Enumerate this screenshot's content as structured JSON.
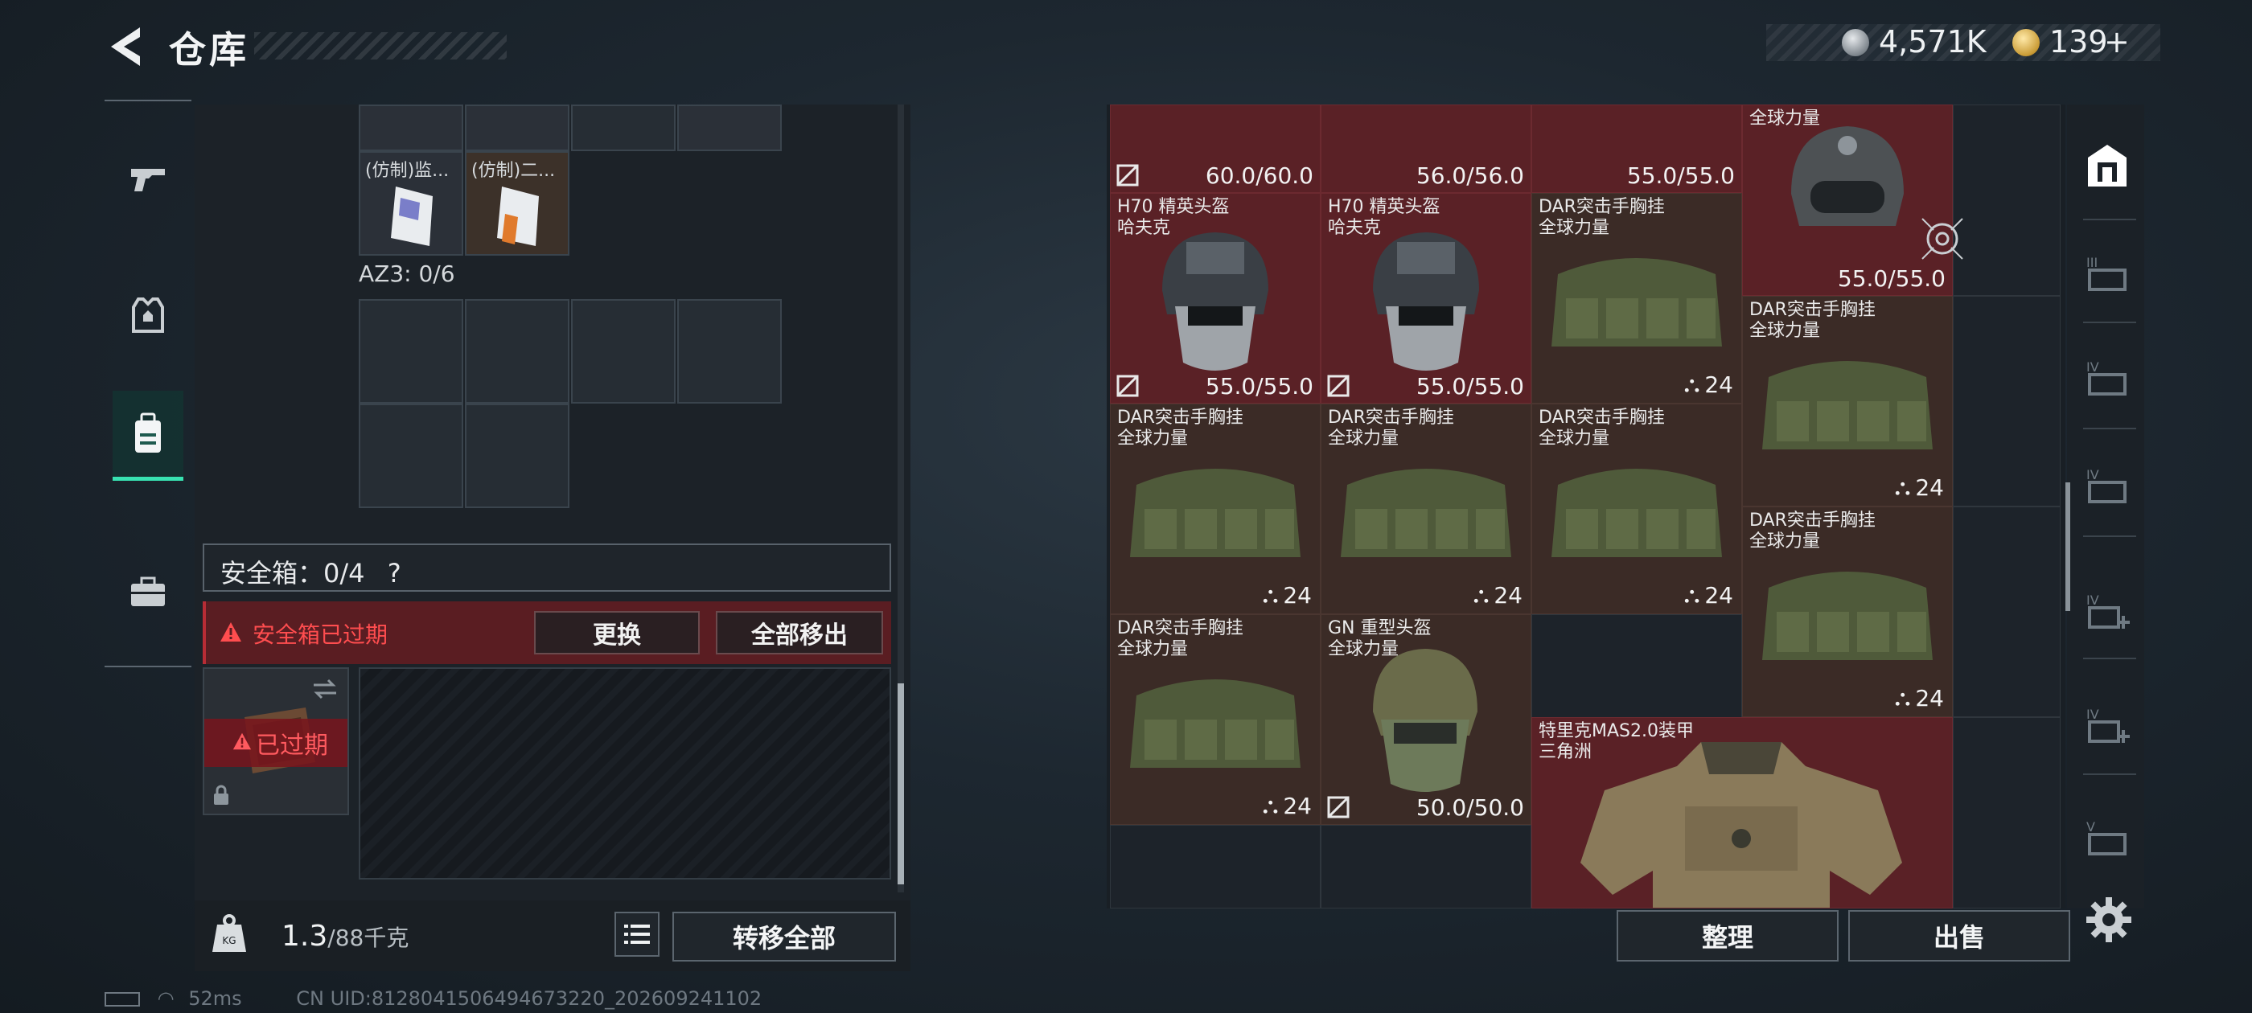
{
  "header": {
    "title": "仓库",
    "currency": [
      {
        "icon": "silver-coin-icon",
        "value": "4,571K"
      },
      {
        "icon": "gold-coin-icon",
        "value": "139"
      }
    ],
    "add_label": "+"
  },
  "left_nav": [
    {
      "icon": "pistol-icon"
    },
    {
      "icon": "armor-vest-icon"
    },
    {
      "icon": "backpack-icon",
      "active": true
    },
    {
      "icon": "toolbox-icon"
    }
  ],
  "storage": {
    "items": [
      {
        "label": "(仿制)监..."
      },
      {
        "label": "(仿制)二..."
      }
    ],
    "az3_label": "AZ3: 0/6",
    "safe_box_label": "安全箱：0/4",
    "help_label": "?",
    "expired_warning": "安全箱已过期",
    "replace_button": "更换",
    "remove_all_button": "全部移出",
    "expired_badge": "已过期",
    "weight": "1.3",
    "weight_max": "/88千克",
    "transfer_all_button": "转移全部"
  },
  "grid_items": [
    {
      "value": "60.0/60.0"
    },
    {
      "value": "56.0/56.0"
    },
    {
      "value": "55.0/55.0"
    },
    {
      "name": "全球力量",
      "value": "55.0/55.0"
    },
    {
      "name": "H70 精英头盔",
      "sub": "哈夫克",
      "value": "55.0/55.0"
    },
    {
      "name": "H70 精英头盔",
      "sub": "哈夫克",
      "value": "55.0/55.0"
    },
    {
      "name": "DAR突击手胸挂",
      "sub": "全球力量",
      "count": "24"
    },
    {
      "name": "DAR突击手胸挂",
      "sub": "全球力量",
      "count": "24"
    },
    {
      "name": "DAR突击手胸挂",
      "sub": "全球力量",
      "count": "24"
    },
    {
      "name": "DAR突击手胸挂",
      "sub": "全球力量",
      "count": "24"
    },
    {
      "name": "DAR突击手胸挂",
      "sub": "全球力量",
      "count": "24"
    },
    {
      "name": "DAR突击手胸挂",
      "sub": "全球力量",
      "count": "24"
    },
    {
      "name": "DAR突击手胸挂",
      "sub": "全球力量",
      "count": "24"
    },
    {
      "name": "GN 重型头盔",
      "sub": "全球力量",
      "value": "50.0/50.0"
    },
    {
      "name": "特里克MAS2.0装甲",
      "sub": "三角洲"
    }
  ],
  "actions": {
    "organize": "整理",
    "sell": "出售"
  },
  "status": {
    "ping": "52ms",
    "uid": "CN UID:8128041506494673220_202609241102"
  }
}
